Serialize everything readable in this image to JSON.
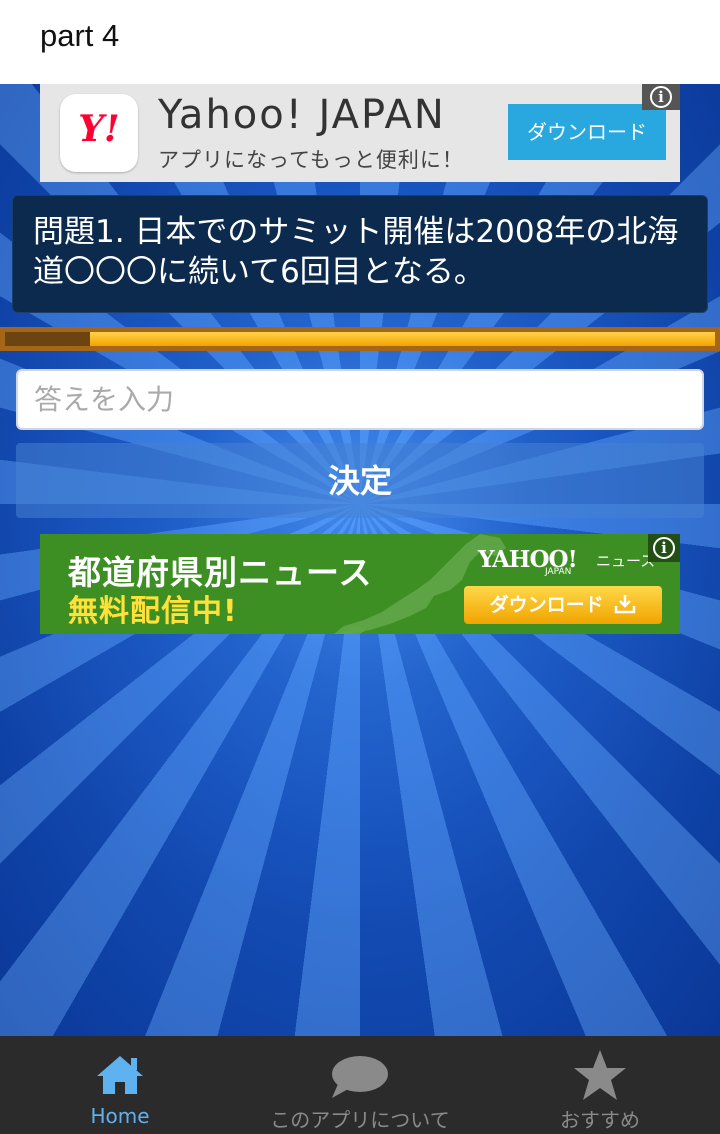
{
  "header": {
    "title": "part 4"
  },
  "ad_top": {
    "logo_text": "Y!",
    "app_name": "Yahoo! JAPAN",
    "tagline": "アプリになってもっと便利に！",
    "download_label": "ダウンロード",
    "info_icon": "info-icon"
  },
  "question": {
    "text": "問題1. 日本でのサミット開催は2008年の北海道〇〇〇に続いて6回目となる。",
    "progress_remaining": 0.88
  },
  "answer_input": {
    "placeholder": "答えを入力",
    "value": ""
  },
  "submit": {
    "label": "決定"
  },
  "ad_news": {
    "headline": "都道府県別ニュース",
    "subheadline": "無料配信中!",
    "brand": "YAHOO!",
    "brand_sub": "JAPAN",
    "brand_news": "ニュース",
    "download_label": "ダウンロード",
    "info_icon": "info-icon"
  },
  "bottom_nav": {
    "items": [
      {
        "label": "Home",
        "icon": "home-icon",
        "active": true
      },
      {
        "label": "このアプリについて",
        "icon": "speech-bubble-icon",
        "active": false
      },
      {
        "label": "おすすめ",
        "icon": "star-icon",
        "active": false
      }
    ]
  },
  "colors": {
    "accent": "#5fb2f0",
    "progress": "#f4a300",
    "ad_green": "#3e8f23",
    "ad_blue_button": "#29a8e0",
    "question_panel": "#0b2a4e"
  }
}
